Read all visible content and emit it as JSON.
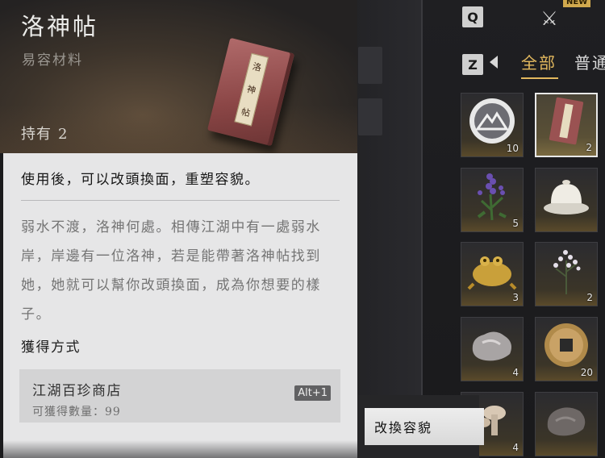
{
  "detail": {
    "title": "洛神帖",
    "subtitle": "易容材料",
    "owned_label": "持有",
    "owned_count": "2",
    "book_label_chars": [
      "洛",
      "神",
      "帖"
    ],
    "usage": "使用後，可以改頭換面，重塑容貌。",
    "description": "弱水不渡，洛神何處。相傳江湖中有一處弱水岸，岸邊有一位洛神，若是能帶著洛神帖找到她，她就可以幫你改頭換面，成為你想要的樣子。",
    "obtain_heading": "獲得方式",
    "shop_name": "江湖百珍商店",
    "shop_qty": "可獲得數量：99",
    "shortcut": "Alt+1"
  },
  "inventory": {
    "hotkey_q": "Q",
    "hotkey_z": "Z",
    "new_badge": "NEW",
    "tab_all": "全部",
    "tab_normal": "普通",
    "accent_color": "#e2b85e",
    "items": [
      {
        "name": "mountain-emblem-icon",
        "count": "10"
      },
      {
        "name": "luoshen-book-icon",
        "count": "2",
        "selected": true
      },
      {
        "name": "lavender-herb-icon",
        "count": "5"
      },
      {
        "name": "porcelain-bowl-icon",
        "count": ""
      },
      {
        "name": "golden-toad-icon",
        "count": "3"
      },
      {
        "name": "white-flower-icon",
        "count": "2"
      },
      {
        "name": "grey-ore-icon",
        "count": "4"
      },
      {
        "name": "bronze-coin-icon",
        "count": "20"
      },
      {
        "name": "mushroom-icon",
        "count": "4"
      },
      {
        "name": "stone-icon",
        "count": ""
      }
    ]
  },
  "tooltip": {
    "label": "改換容貌"
  }
}
